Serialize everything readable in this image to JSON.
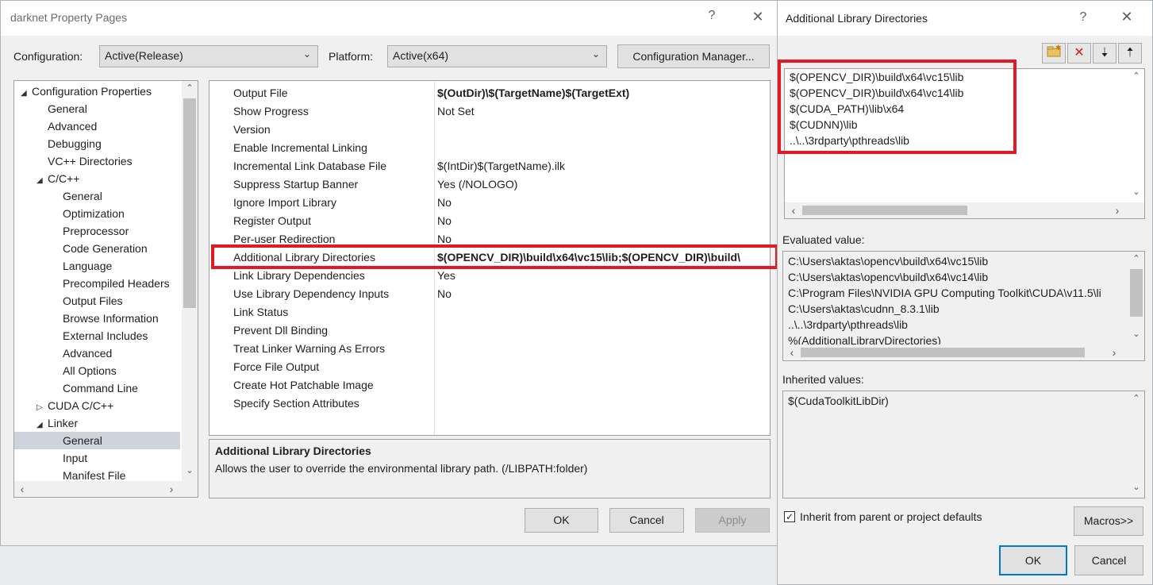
{
  "main_window": {
    "title": "darknet Property Pages",
    "help_glyph": "?",
    "close_glyph": "✕",
    "configuration_label": "Configuration:",
    "configuration_value": "Active(Release)",
    "platform_label": "Platform:",
    "platform_value": "Active(x64)",
    "config_manager_button": "Configuration Manager...",
    "tree": [
      {
        "label": "Configuration Properties",
        "level": 0,
        "arrow": "◢"
      },
      {
        "label": "General",
        "level": 1
      },
      {
        "label": "Advanced",
        "level": 1
      },
      {
        "label": "Debugging",
        "level": 1
      },
      {
        "label": "VC++ Directories",
        "level": 1
      },
      {
        "label": "C/C++",
        "level": 1,
        "arrow": "◢"
      },
      {
        "label": "General",
        "level": 2
      },
      {
        "label": "Optimization",
        "level": 2
      },
      {
        "label": "Preprocessor",
        "level": 2
      },
      {
        "label": "Code Generation",
        "level": 2
      },
      {
        "label": "Language",
        "level": 2
      },
      {
        "label": "Precompiled Headers",
        "level": 2
      },
      {
        "label": "Output Files",
        "level": 2
      },
      {
        "label": "Browse Information",
        "level": 2
      },
      {
        "label": "External Includes",
        "level": 2
      },
      {
        "label": "Advanced",
        "level": 2
      },
      {
        "label": "All Options",
        "level": 2
      },
      {
        "label": "Command Line",
        "level": 2
      },
      {
        "label": "CUDA C/C++",
        "level": 1,
        "arrow": "▷"
      },
      {
        "label": "Linker",
        "level": 1,
        "arrow": "◢"
      },
      {
        "label": "General",
        "level": 2,
        "selected": true
      },
      {
        "label": "Input",
        "level": 2
      },
      {
        "label": "Manifest File",
        "level": 2
      }
    ],
    "grid": [
      {
        "name": "Output File",
        "value": "$(OutDir)\\$(TargetName)$(TargetExt)",
        "bold": true
      },
      {
        "name": "Show Progress",
        "value": "Not Set"
      },
      {
        "name": "Version",
        "value": ""
      },
      {
        "name": "Enable Incremental Linking",
        "value": ""
      },
      {
        "name": "Incremental Link Database File",
        "value": "$(IntDir)$(TargetName).ilk"
      },
      {
        "name": "Suppress Startup Banner",
        "value": "Yes (/NOLOGO)"
      },
      {
        "name": "Ignore Import Library",
        "value": "No"
      },
      {
        "name": "Register Output",
        "value": "No"
      },
      {
        "name": "Per-user Redirection",
        "value": "No"
      },
      {
        "name": "Additional Library Directories",
        "value": "$(OPENCV_DIR)\\build\\x64\\vc15\\lib;$(OPENCV_DIR)\\build\\",
        "bold": true
      },
      {
        "name": "Link Library Dependencies",
        "value": "Yes"
      },
      {
        "name": "Use Library Dependency Inputs",
        "value": "No"
      },
      {
        "name": "Link Status",
        "value": ""
      },
      {
        "name": "Prevent Dll Binding",
        "value": ""
      },
      {
        "name": "Treat Linker Warning As Errors",
        "value": ""
      },
      {
        "name": "Force File Output",
        "value": ""
      },
      {
        "name": "Create Hot Patchable Image",
        "value": ""
      },
      {
        "name": "Specify Section Attributes",
        "value": ""
      }
    ],
    "description_title": "Additional Library Directories",
    "description_text": "Allows the user to override the environmental library path. (/LIBPATH:folder)",
    "ok_button": "OK",
    "cancel_button": "Cancel",
    "apply_button": "Apply"
  },
  "dialog": {
    "title": "Additional Library Directories",
    "help_glyph": "?",
    "close_glyph": "✕",
    "directories": [
      "$(OPENCV_DIR)\\build\\x64\\vc15\\lib",
      "$(OPENCV_DIR)\\build\\x64\\vc14\\lib",
      "$(CUDA_PATH)\\lib\\x64",
      "$(CUDNN)\\lib",
      "..\\..\\3rdparty\\pthreads\\lib"
    ],
    "evaluated_label": "Evaluated value:",
    "evaluated_values": [
      "C:\\Users\\aktas\\opencv\\build\\x64\\vc15\\lib",
      "C:\\Users\\aktas\\opencv\\build\\x64\\vc14\\lib",
      "C:\\Program Files\\NVIDIA GPU Computing Toolkit\\CUDA\\v11.5\\li",
      "C:\\Users\\aktas\\cudnn_8.3.1\\lib",
      "..\\..\\3rdparty\\pthreads\\lib",
      "%(AdditionalLibraryDirectories)"
    ],
    "inherited_label": "Inherited values:",
    "inherited_values": [
      "$(CudaToolkitLibDir)"
    ],
    "inherit_checkbox_label": "Inherit from parent or project defaults",
    "inherit_checked": true,
    "macros_button": "Macros>>",
    "ok_button": "OK",
    "cancel_button": "Cancel"
  },
  "colors": {
    "highlight": "#e11b22",
    "selection": "#cfd3dc",
    "focus": "#0078d7"
  }
}
